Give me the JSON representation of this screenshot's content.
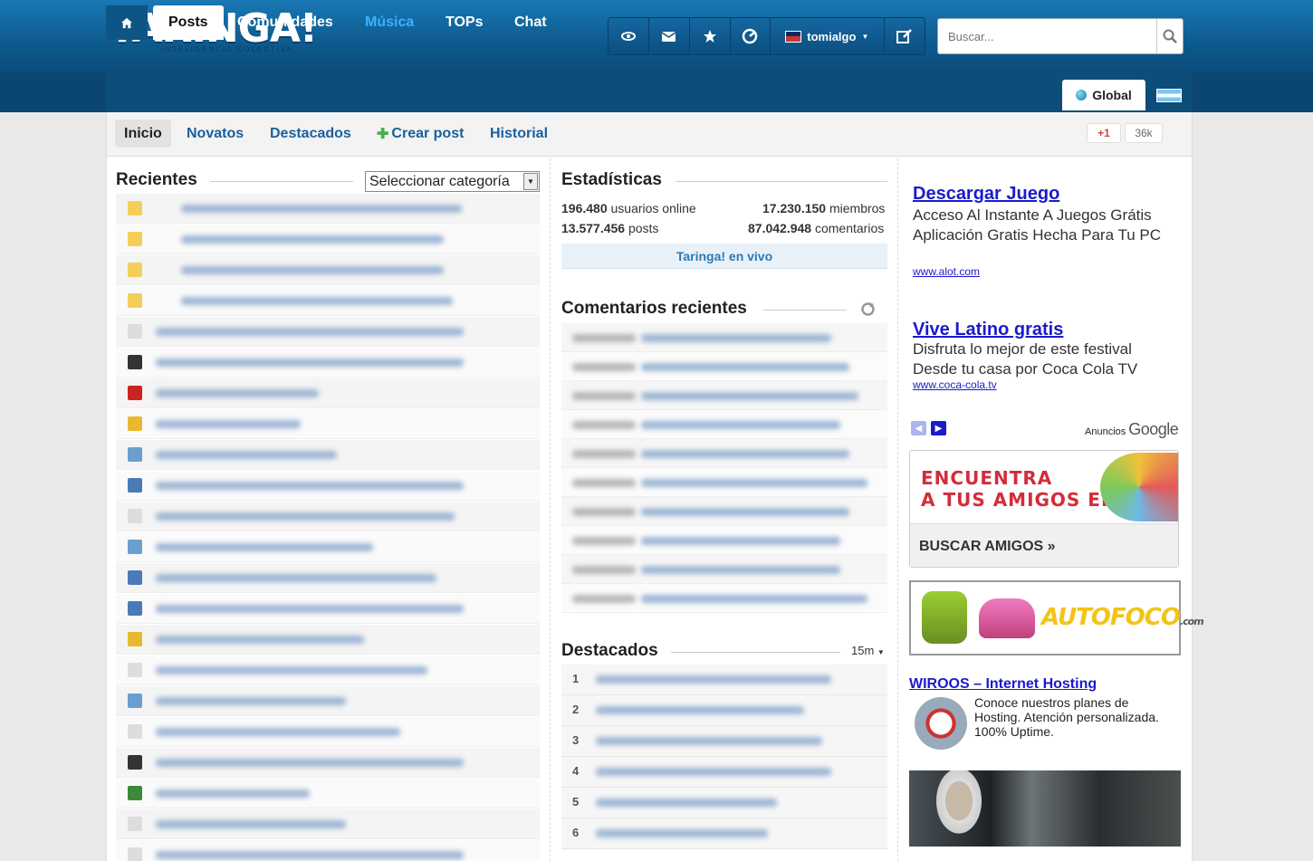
{
  "header": {
    "logo": "TARINGA!",
    "tagline": "INTELIGENCIA COLECTIVA",
    "username": "tomialgo",
    "search_placeholder": "Buscar..."
  },
  "nav": {
    "tabs": [
      {
        "label": "Posts"
      },
      {
        "label": "Comunidades"
      },
      {
        "label": "Música"
      },
      {
        "label": "TOPs"
      },
      {
        "label": "Chat"
      }
    ],
    "global_label": "Global"
  },
  "subnav": {
    "items": [
      {
        "label": "Inicio"
      },
      {
        "label": "Novatos"
      },
      {
        "label": "Destacados"
      },
      {
        "label": "Crear post"
      },
      {
        "label": "Historial"
      }
    ],
    "gplus_label": "+1",
    "gplus_count": "36k"
  },
  "recientes": {
    "title": "Recientes",
    "category_select": "Seleccionar categoría"
  },
  "estadisticas": {
    "title": "Estadísticas",
    "online_count": "196.480",
    "online_label": "usuarios online",
    "members_count": "17.230.150",
    "members_label": "miembros",
    "posts_count": "13.577.456",
    "posts_label": "posts",
    "comments_count": "87.042.948",
    "comments_label": "comentarios",
    "live_link": "Taringa! en vivo"
  },
  "comentarios": {
    "title": "Comentarios recientes"
  },
  "destacados": {
    "title": "Destacados",
    "period": "15m",
    "numbers": [
      "1",
      "2",
      "3",
      "4",
      "5",
      "6"
    ]
  },
  "ads": {
    "ad1": {
      "title": "Descargar Juego",
      "body": "Acceso Al Instante A Juegos Grátis Aplicación Gratis Hecha Para Tu PC",
      "url": "www.alot.com"
    },
    "ad2": {
      "title": "Vive Latino gratis",
      "body": "Disfruta lo mejor de este festival Desde tu casa por Coca Cola TV",
      "url": "www.coca-cola.tv"
    },
    "anuncios_label": "Anuncios",
    "google_label": "Google",
    "amigos_line1": "ENCUENTRA",
    "amigos_line2": "A TUS AMIGOS EN T!",
    "amigos_button": "BUSCAR AMIGOS »",
    "autofoco_label": "AUTOFOCO",
    "autofoco_suffix": ".com",
    "wiroos_title": "WIROOS – Internet Hosting",
    "wiroos_body": "Conoce nuestros planes de Hosting. Atención personalizada. 100% Uptime."
  },
  "colors": {
    "header_blue": "#0d5a8e",
    "link_blue": "#1a5f9e",
    "ad_link": "#1a1acc"
  }
}
